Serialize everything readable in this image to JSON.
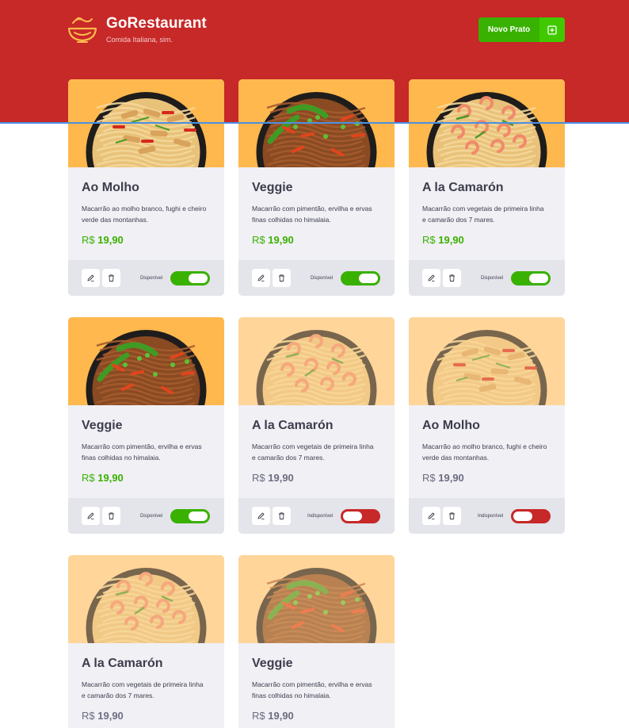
{
  "header": {
    "title": "GoRestaurant",
    "subtitle": "Comida Italiana, sim.",
    "new_button_label": "Novo Prato"
  },
  "colors": {
    "brand_red": "#c72828",
    "accent_green": "#39b100",
    "card_bg": "#f0f0f5"
  },
  "foods": [
    {
      "name": "Ao Molho",
      "description": "Macarrão ao molho branco, fughi e cheiro verde das montanhas.",
      "currency": "R$",
      "price": "19,90",
      "status": "Disponível",
      "available": true,
      "dish": "chicken"
    },
    {
      "name": "Veggie",
      "description": "Macarrão com pimentão, ervilha e ervas finas colhidas no himalaia.",
      "currency": "R$",
      "price": "19,90",
      "status": "Disponível",
      "available": true,
      "dish": "veggie"
    },
    {
      "name": "A la Camarón",
      "description": "Macarrão com vegetais de primeira linha e camarão dos 7 mares.",
      "currency": "R$",
      "price": "19,90",
      "status": "Disponível",
      "available": true,
      "dish": "shrimp"
    },
    {
      "name": "Veggie",
      "description": "Macarrão com pimentão, ervilha e ervas finas colhidas no himalaia.",
      "currency": "R$",
      "price": "19,90",
      "status": "Disponível",
      "available": true,
      "dish": "veggie"
    },
    {
      "name": "A la Camarón",
      "description": "Macarrão com vegetais de primeira linha e camarão dos 7 mares.",
      "currency": "R$",
      "price": "19,90",
      "status": "Indisponível",
      "available": false,
      "dish": "shrimp"
    },
    {
      "name": "Ao Molho",
      "description": "Macarrão ao molho branco, fughi e cheiro verde das montanhas.",
      "currency": "R$",
      "price": "19,90",
      "status": "Indisponível",
      "available": false,
      "dish": "chicken"
    },
    {
      "name": "A la Camarón",
      "description": "Macarrão com vegetais de primeira linha e camarão dos 7 mares.",
      "currency": "R$",
      "price": "19,90",
      "status": "",
      "available": false,
      "dish": "shrimp"
    },
    {
      "name": "Veggie",
      "description": "Macarrão com pimentão, ervilha e ervas finas colhidas no himalaia.",
      "currency": "R$",
      "price": "19,90",
      "status": "",
      "available": false,
      "dish": "veggie"
    }
  ]
}
